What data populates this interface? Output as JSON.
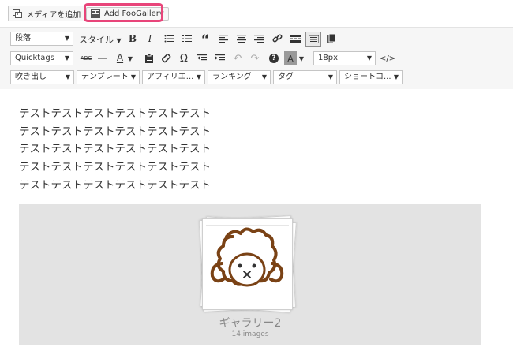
{
  "top": {
    "add_media": "メディアを追加",
    "add_foogallery": "Add FooGallery"
  },
  "toolbar": {
    "row1": {
      "format": "段落",
      "style": "スタイル",
      "bold": "B",
      "italic": "I",
      "quote": "“"
    },
    "row2": {
      "quicktags": "Quicktags",
      "abc": "ABC",
      "text_color": "A",
      "bg_color": "A",
      "omega": "Ω",
      "fontsize": "18px",
      "help": "?"
    },
    "row3": [
      "吹き出し",
      "テンプレート",
      "アフィリエ...",
      "ランキング",
      "タグ",
      "ショートコ..."
    ]
  },
  "editor": {
    "lines": [
      "テストテストテストテストテストテスト",
      "テストテストテストテストテストテスト",
      "テストテストテストテストテストテスト",
      "テストテストテストテストテストテスト",
      "テストテストテストテストテストテスト"
    ],
    "gallery": {
      "title": "ギャラリー2",
      "count": "14 images"
    }
  },
  "colors": {
    "highlight": "#e8457a",
    "illustration": "#7a4215",
    "gallery_bg": "#e3e3e3"
  }
}
